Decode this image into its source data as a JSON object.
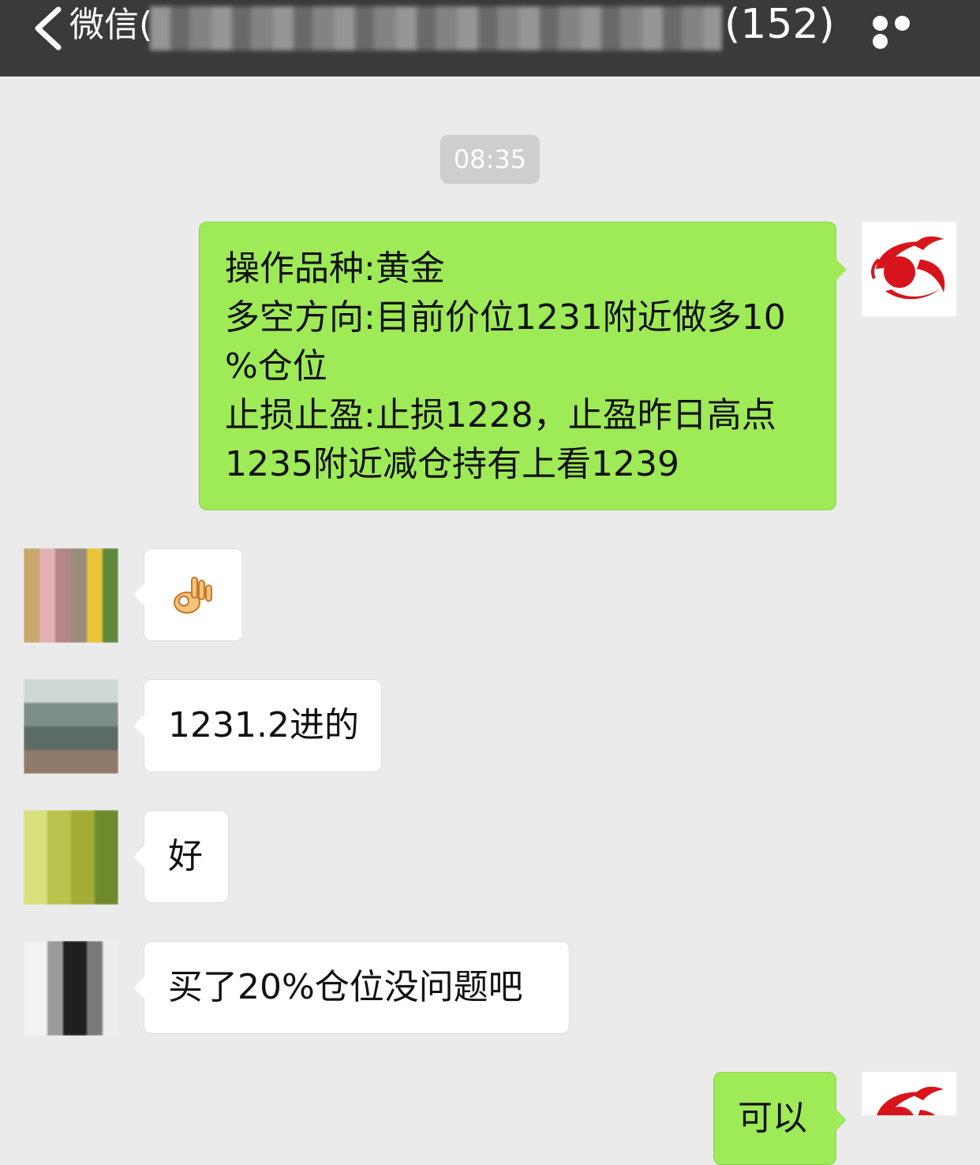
{
  "nav": {
    "back_label": "微信(",
    "member_count": "(152)"
  },
  "chat": {
    "timestamp": "08:35",
    "messages": [
      {
        "side": "right",
        "lines": [
          "操作品种:黄金",
          "多空方向:目前价位1231附近做多10",
          "%仓位",
          "止损止盈:止损1228，止盈昨日高点",
          "1235附近减仓持有上看1239"
        ]
      },
      {
        "side": "left",
        "emoji": "ok-hand"
      },
      {
        "side": "left",
        "text": "1231.2进的"
      },
      {
        "side": "left",
        "text": "好"
      },
      {
        "side": "left",
        "text": "买了20%仓位没问题吧"
      },
      {
        "side": "right",
        "text": "可以"
      }
    ]
  },
  "colors": {
    "nav_bg": "#3a3a3c",
    "chat_bg": "#ebebeb",
    "bubble_green": "#9eea57",
    "bubble_white": "#ffffff",
    "timestamp_bg": "#cecece",
    "logo_red": "#d7141b"
  }
}
